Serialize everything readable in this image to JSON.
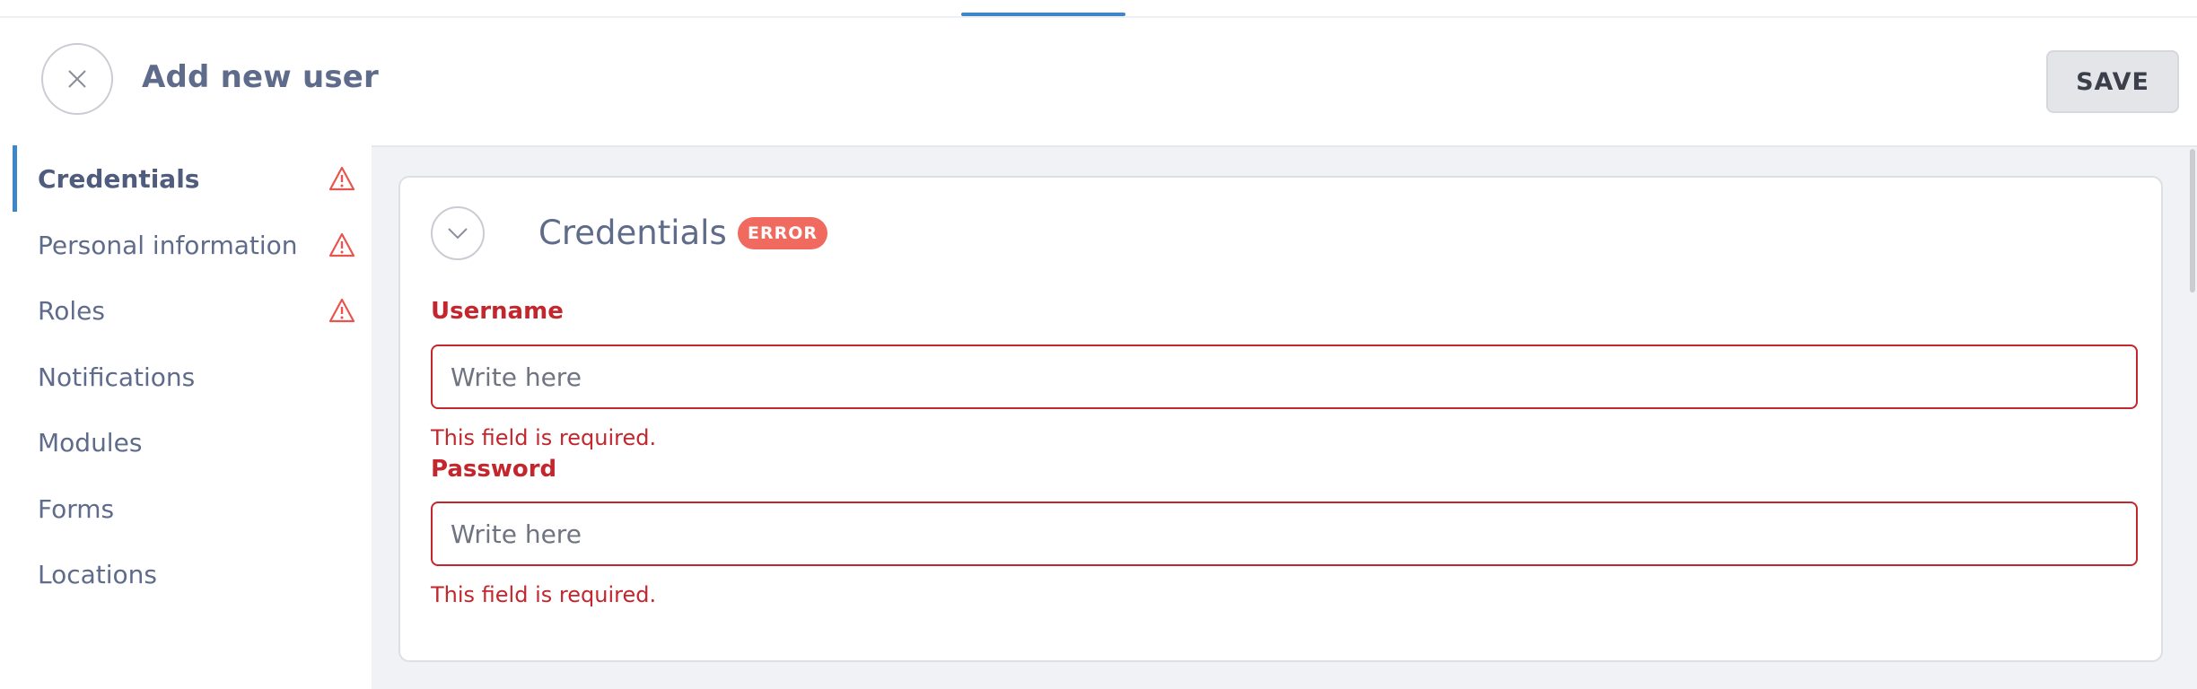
{
  "header": {
    "title": "Add new user",
    "save_label": "SAVE"
  },
  "sidebar": {
    "items": [
      {
        "label": "Credentials",
        "active": true,
        "warning": true
      },
      {
        "label": "Personal information",
        "active": false,
        "warning": true
      },
      {
        "label": "Roles",
        "active": false,
        "warning": true
      },
      {
        "label": "Notifications",
        "active": false,
        "warning": false
      },
      {
        "label": "Modules",
        "active": false,
        "warning": false
      },
      {
        "label": "Forms",
        "active": false,
        "warning": false
      },
      {
        "label": "Locations",
        "active": false,
        "warning": false
      }
    ]
  },
  "section": {
    "title": "Credentials",
    "badge": "ERROR"
  },
  "form": {
    "username": {
      "label": "Username",
      "value": "",
      "placeholder": "Write here",
      "error": "This field is required."
    },
    "password": {
      "label": "Password",
      "value": "",
      "placeholder": "Write here",
      "error": "This field is required."
    }
  },
  "icons": {
    "close": "close-icon",
    "collapse": "chevron-down-icon",
    "warning": "warning-triangle-icon"
  },
  "colors": {
    "accent": "#3d87c9",
    "error": "#c3262d",
    "badge": "#f06a5f",
    "text": "#5f6b8a"
  }
}
